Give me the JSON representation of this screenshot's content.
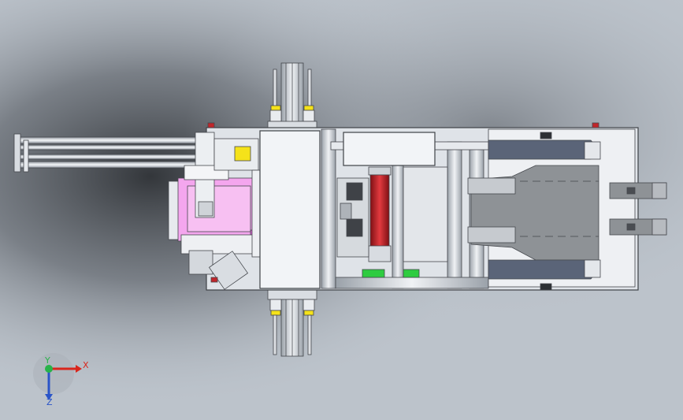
{
  "viewport": {
    "background": "#bcc3cb",
    "shadow_color": "#3a3e44"
  },
  "colors": {
    "frame": "#dfe3e8",
    "frame_stroke": "#4a4d52",
    "panel": "#f2f4f7",
    "pink": "#f4a6ee",
    "red_cylinder": "#c0262b",
    "green": "#2ecc40",
    "yellow": "#f5e21a",
    "gray_plate": "#8e9296",
    "dark_blue_gray": "#5a6478",
    "axis_x": "#d9261c",
    "axis_y": "#28b34a",
    "axis_z": "#2a54c8"
  },
  "triad": {
    "x_label": "X",
    "y_label": "Y",
    "z_label": "Z"
  }
}
